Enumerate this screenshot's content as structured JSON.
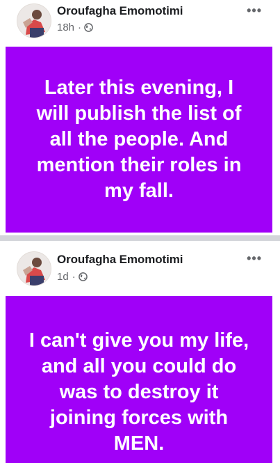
{
  "posts": [
    {
      "author": "Oroufagha Emomotimi",
      "time": "18h",
      "separator": "·",
      "more": "•••",
      "text": "Later this evening, I will publish the list of all the people. And mention their roles in my fall.",
      "background_color": "#a000f8",
      "privacy_icon": "globe-icon"
    },
    {
      "author": "Oroufagha Emomotimi",
      "time": "1d",
      "separator": "·",
      "more": "•••",
      "text": "I can't give you my life, and all you could do was to destroy it joining forces with MEN.",
      "background_color": "#a000f8",
      "privacy_icon": "globe-icon"
    }
  ]
}
